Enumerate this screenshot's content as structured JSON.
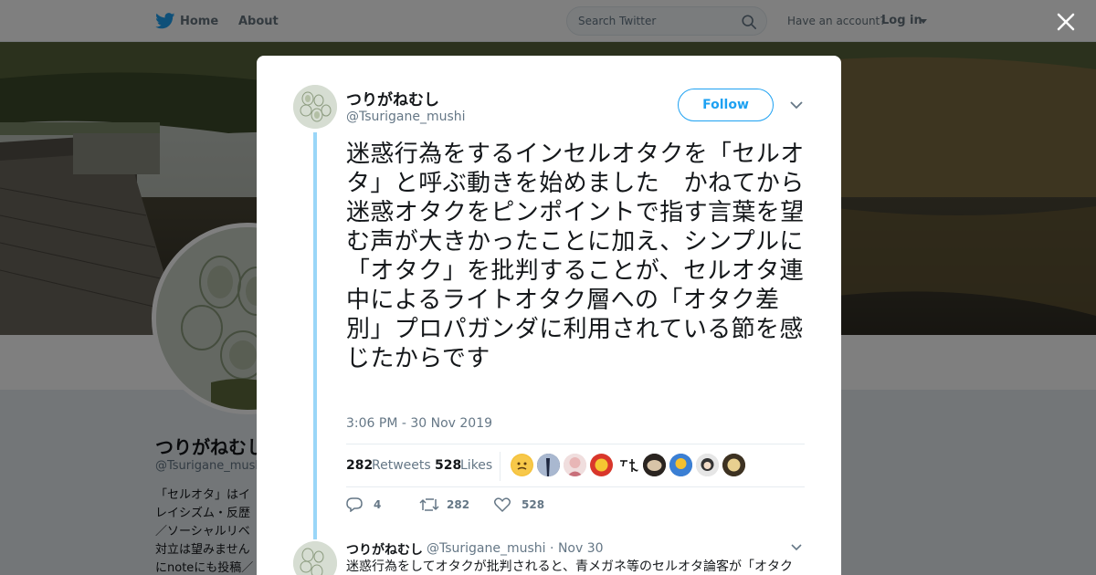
{
  "nav": {
    "home_label": "Home",
    "about_label": "About",
    "search_placeholder": "Search Twitter",
    "account_prompt": "Have an account?",
    "login_label": "Log in"
  },
  "profile_background": {
    "name": "つりがねむし",
    "handle": "@Tsurigane_mushi",
    "bio_lines": [
      "「セルオタ」はイ",
      "レイシズム・反歴",
      "／ソーシャルリベ",
      "対立は望みません",
      "にnoteにも投稿／"
    ]
  },
  "tweet": {
    "author_name": "つりがねむし",
    "author_handle": "@Tsurigane_mushi",
    "follow_label": "Follow",
    "text": "迷惑行為をするインセルオタクを「セルオタ」と呼ぶ動きを始めました　かねてから迷惑オタクをピンポイントで指す言葉を望む声が大きかったことに加え、シンプルに「オタク」を批判することが、セルオタ連中によるライトオタク層への「オタク差別」プロパガンダに利用されている節を感じたからです",
    "timestamp": "3:06 PM - 30 Nov 2019",
    "retweets_count": "282",
    "retweets_label": "Retweets",
    "likes_count": "528",
    "likes_label": "Likes",
    "reply_count": "4",
    "retweet_action_count": "282",
    "like_action_count": "528"
  },
  "reply": {
    "author_name": "つりがねむし",
    "author_handle": "@Tsurigane_mushi",
    "separator": "·",
    "date": "Nov 30",
    "text": "迷惑行為をしてオタクが批判されると、青メガネ等のセルオタ論客が「オタク"
  },
  "colors": {
    "accent": "#1da1f2",
    "thread_line": "#9ad6f8",
    "secondary_text": "#657786"
  },
  "icons": [
    "twitter-bird-icon",
    "search-icon",
    "close-icon",
    "chevron-down-icon",
    "reply-icon",
    "retweet-icon",
    "heart-icon"
  ]
}
